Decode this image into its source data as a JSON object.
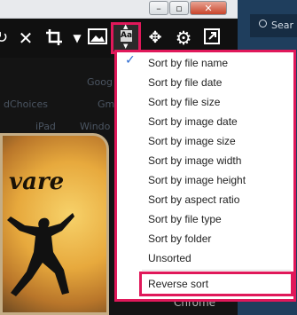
{
  "search": {
    "placeholder": "Sear"
  },
  "background_texts": {
    "ghost_1": "Goog",
    "ghost_2": "dChoices",
    "ghost_3": "Gm",
    "ghost_4": "iPad",
    "ghost_5": "Windo",
    "chrome": "Chrome"
  },
  "photo": {
    "text": "vare"
  },
  "sort_button": {
    "label": "Aa"
  },
  "menu": {
    "items": [
      {
        "label": "Sort by file name",
        "checked": true
      },
      {
        "label": "Sort by file date"
      },
      {
        "label": "Sort by file size"
      },
      {
        "label": "Sort by image date"
      },
      {
        "label": "Sort by image size"
      },
      {
        "label": "Sort by image width"
      },
      {
        "label": "Sort by image height"
      },
      {
        "label": "Sort by aspect ratio"
      },
      {
        "label": "Sort by file type"
      },
      {
        "label": "Sort by folder"
      },
      {
        "label": "Unsorted"
      }
    ],
    "reverse_label": "Reverse sort"
  },
  "colors": {
    "highlight": "#e0185a",
    "check": "#2c6bd1"
  }
}
